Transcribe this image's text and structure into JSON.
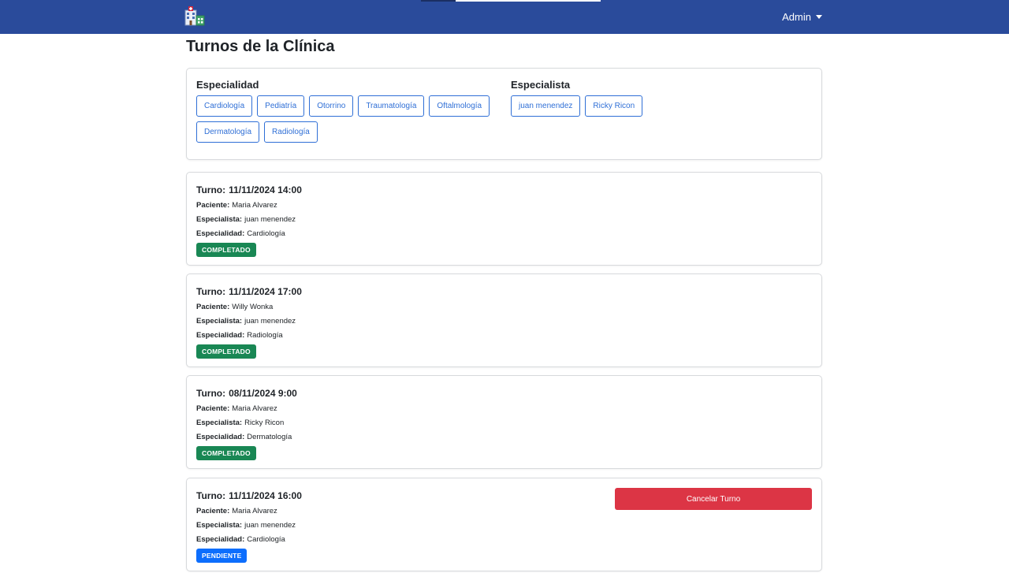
{
  "header": {
    "user_label": "Admin",
    "accent_color": "#2a4b9b"
  },
  "page_title": "Turnos de la Clínica",
  "filters": {
    "specialty_heading": "Especialidad",
    "specialties": [
      "Cardiología",
      "Pediatría",
      "Otorrino",
      "Traumatología",
      "Oftalmología",
      "Dermatología",
      "Radiología"
    ],
    "specialist_heading": "Especialista",
    "specialists": [
      "juan menendez",
      "Ricky Ricon"
    ]
  },
  "labels": {
    "turn_prefix": "Turno:",
    "patient": "Paciente:",
    "specialist": "Especialista:",
    "specialty": "Especialidad:",
    "cancel_button": "Cancelar Turno"
  },
  "turns": [
    {
      "datetime": "11/11/2024 14:00",
      "patient": "Maria Alvarez",
      "specialist": "juan menendez",
      "specialty": "Cardiología",
      "status": "COMPLETADO",
      "status_color": "#198754",
      "can_cancel": false
    },
    {
      "datetime": "11/11/2024 17:00",
      "patient": "Willy Wonka",
      "specialist": "juan menendez",
      "specialty": "Radiología",
      "status": "COMPLETADO",
      "status_color": "#198754",
      "can_cancel": false
    },
    {
      "datetime": "08/11/2024 9:00",
      "patient": "Maria Alvarez",
      "specialist": "Ricky Ricon",
      "specialty": "Dermatología",
      "status": "COMPLETADO",
      "status_color": "#198754",
      "can_cancel": false
    },
    {
      "datetime": "11/11/2024 16:00",
      "patient": "Maria Alvarez",
      "specialist": "juan menendez",
      "specialty": "Cardiología",
      "status": "PENDIENTE",
      "status_color": "#0d6efd",
      "can_cancel": true
    }
  ]
}
